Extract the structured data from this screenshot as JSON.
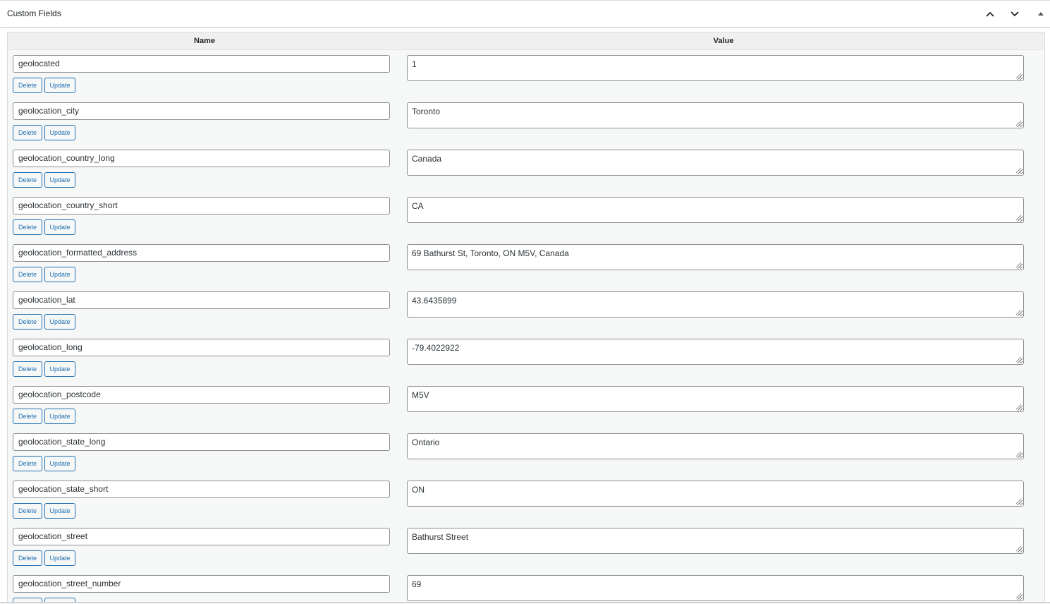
{
  "panel": {
    "title": "Custom Fields",
    "move_up_icon": "chevron-up-icon",
    "move_down_icon": "chevron-down-icon",
    "toggle_icon": "triangle-up-icon"
  },
  "table": {
    "headers": {
      "name": "Name",
      "value": "Value"
    },
    "delete_label": "Delete",
    "update_label": "Update",
    "rows": [
      {
        "key": "geolocated",
        "value": "1"
      },
      {
        "key": "geolocation_city",
        "value": "Toronto"
      },
      {
        "key": "geolocation_country_long",
        "value": "Canada"
      },
      {
        "key": "geolocation_country_short",
        "value": "CA"
      },
      {
        "key": "geolocation_formatted_address",
        "value": "69 Bathurst St, Toronto, ON M5V, Canada"
      },
      {
        "key": "geolocation_lat",
        "value": "43.6435899"
      },
      {
        "key": "geolocation_long",
        "value": "-79.4022922"
      },
      {
        "key": "geolocation_postcode",
        "value": "M5V"
      },
      {
        "key": "geolocation_state_long",
        "value": "Ontario"
      },
      {
        "key": "geolocation_state_short",
        "value": "ON"
      },
      {
        "key": "geolocation_street",
        "value": "Bathurst Street"
      },
      {
        "key": "geolocation_street_number",
        "value": "69"
      }
    ]
  },
  "colors": {
    "accent": "#2271b1",
    "border": "#8c8f94",
    "background": "#f6f7f7"
  }
}
